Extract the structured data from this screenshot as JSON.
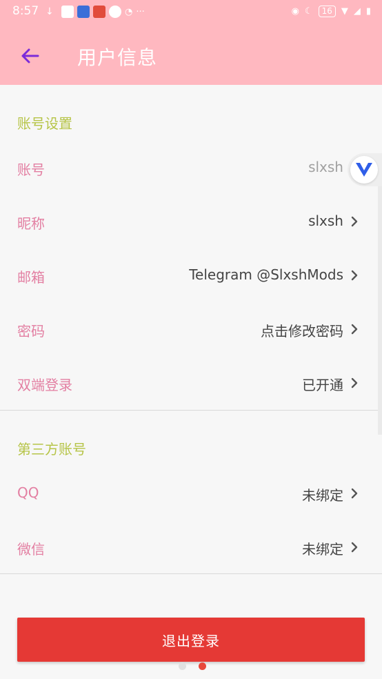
{
  "status_bar": {
    "time": "8:57",
    "battery": "16"
  },
  "appbar": {
    "title": "用户信息"
  },
  "sections": {
    "account": {
      "header": "账号设置",
      "rows": [
        {
          "label": "账号",
          "value": "slxsh"
        },
        {
          "label": "昵称",
          "value": "slxsh"
        },
        {
          "label": "邮箱",
          "value": "Telegram @SlxshMods"
        },
        {
          "label": "密码",
          "value": "点击修改密码"
        },
        {
          "label": "双端登录",
          "value": "已开通"
        }
      ]
    },
    "third_party": {
      "header": "第三方账号",
      "rows": [
        {
          "label": "QQ",
          "value": "未绑定"
        },
        {
          "label": "微信",
          "value": "未绑定"
        }
      ]
    }
  },
  "logout": {
    "label": "退出登录"
  },
  "colors": {
    "appbar": "#ffb8c0",
    "section_header": "#b6c447",
    "label": "#e37fa2",
    "logout": "#e53935",
    "back_arrow": "#7b2bd9"
  },
  "icons": {
    "back": "arrow-left-icon",
    "chevron": "chevron-right-icon",
    "float": "v-logo-icon"
  }
}
